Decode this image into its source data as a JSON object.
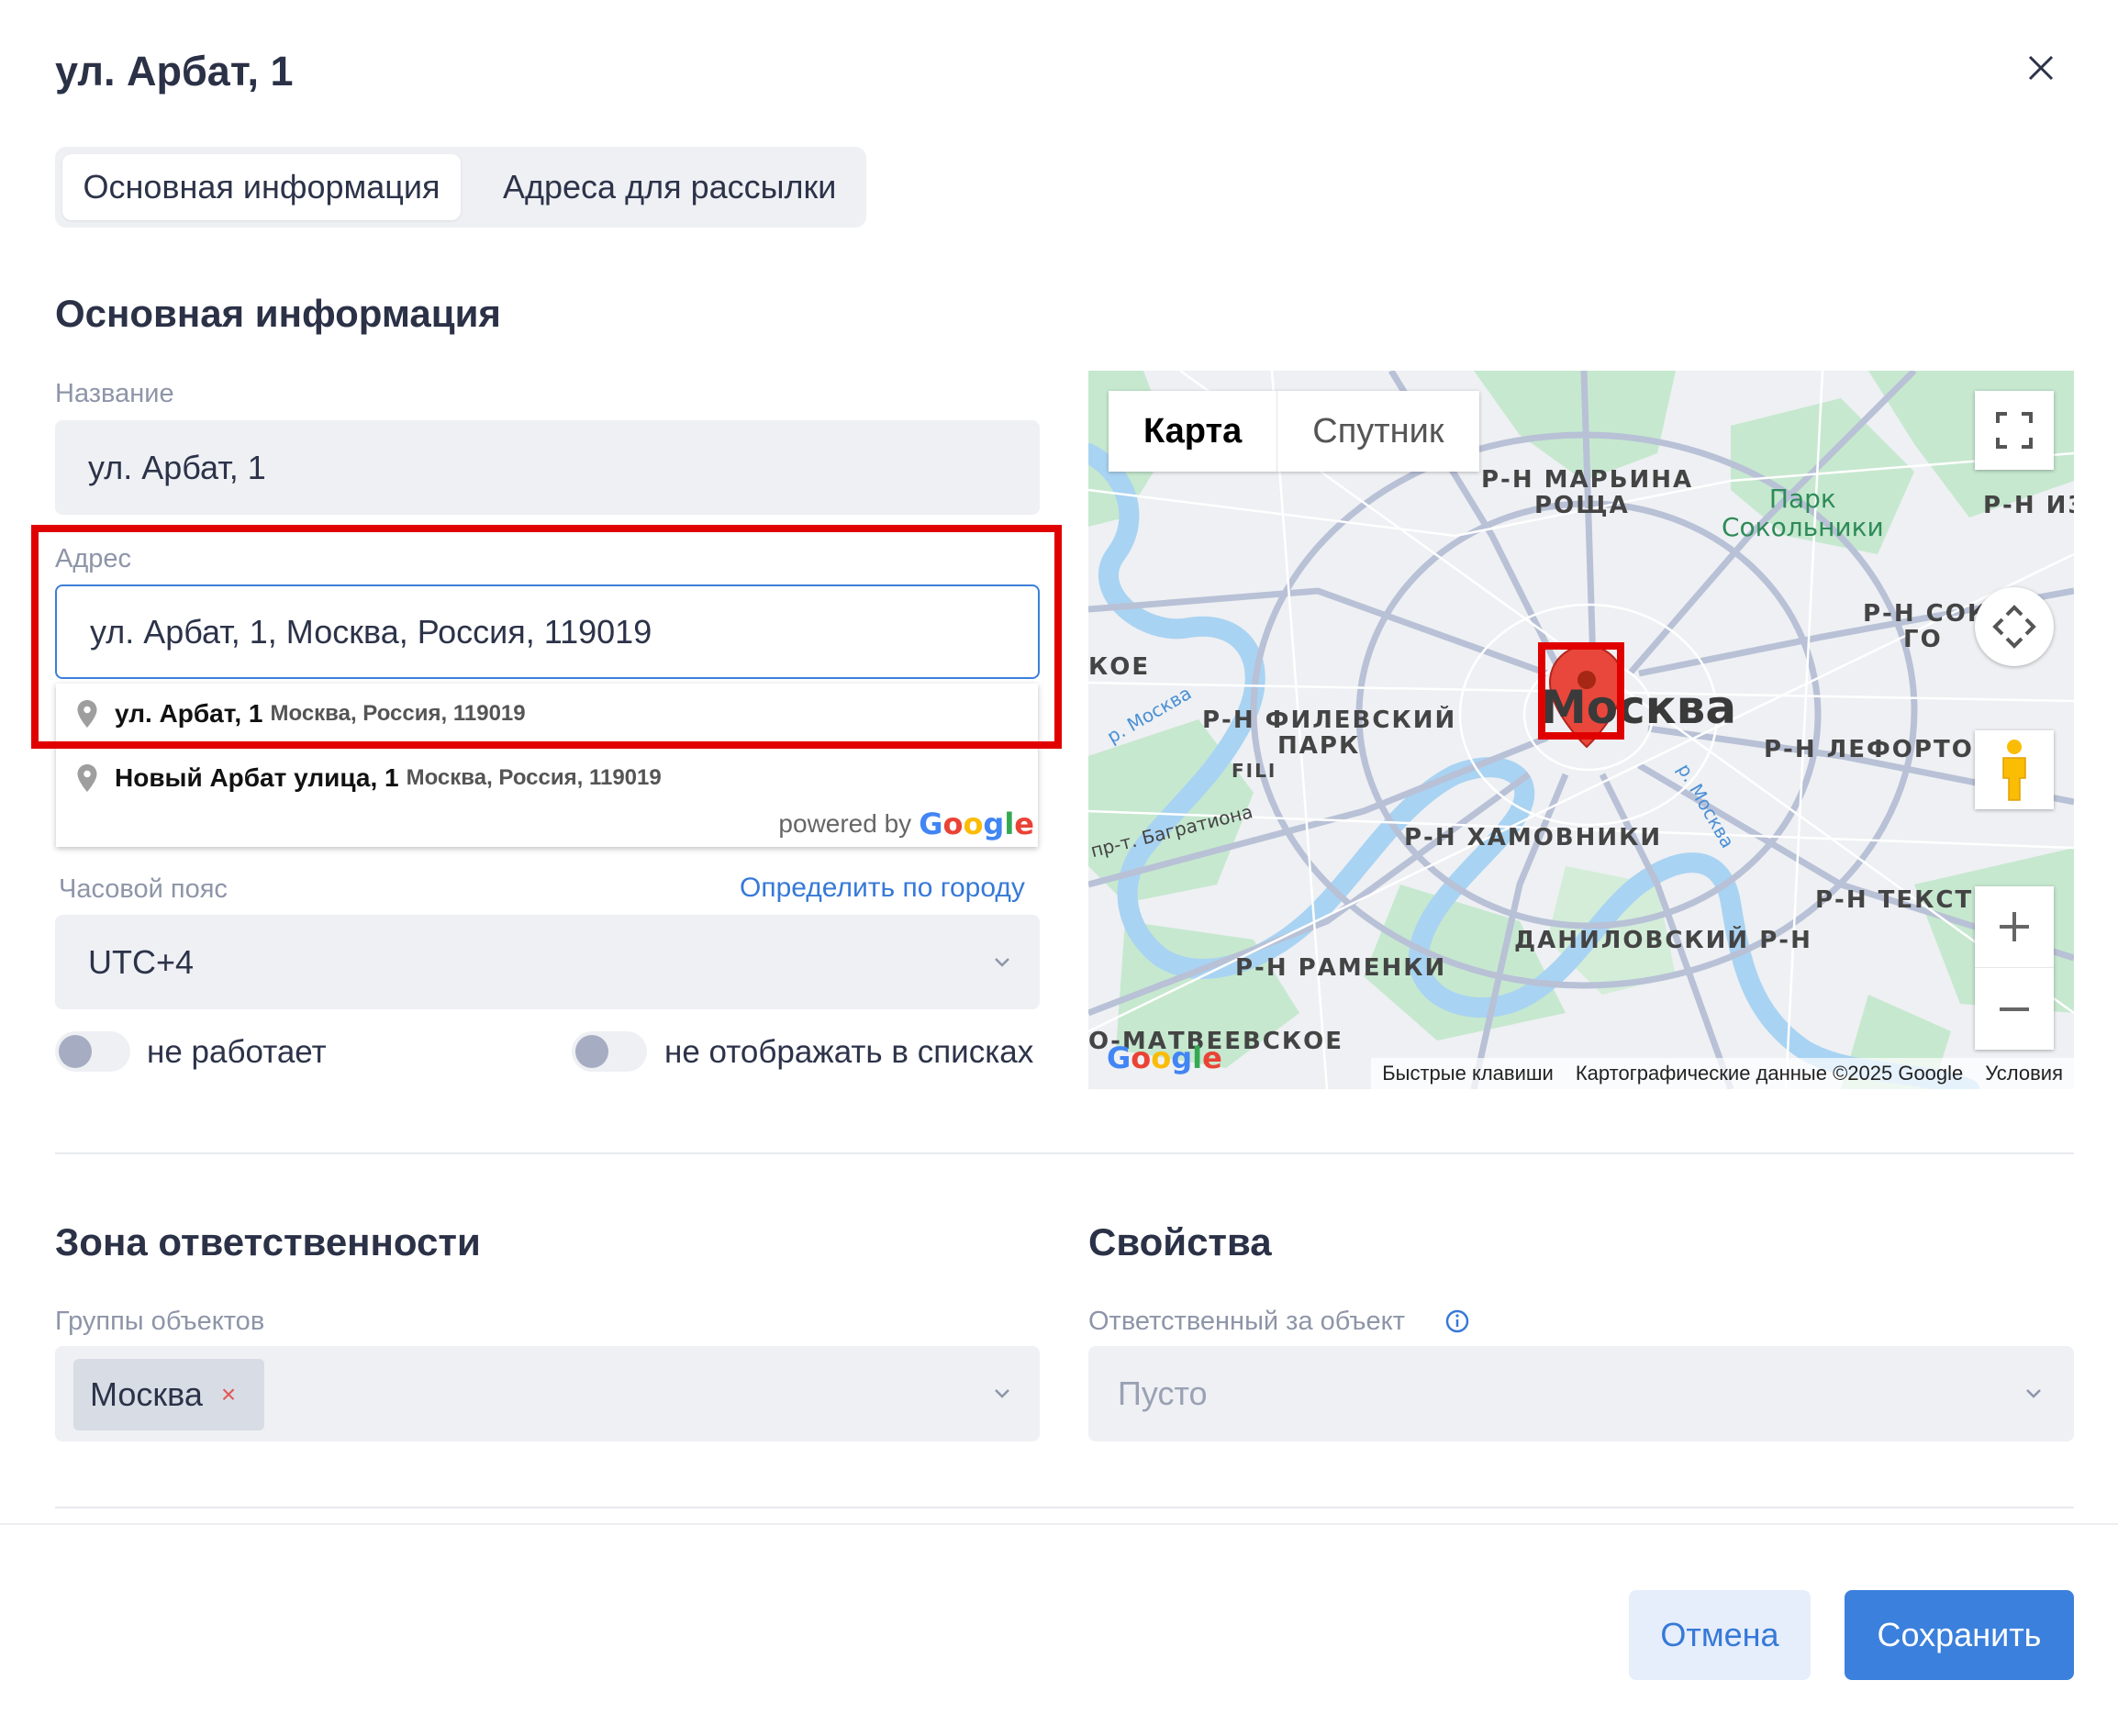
{
  "dialog": {
    "title": "ул. Арбат, 1"
  },
  "tabs": [
    {
      "label": "Основная информация",
      "active": true
    },
    {
      "label": "Адреса для рассылки",
      "active": false
    }
  ],
  "main_info": {
    "section_title": "Основная информация",
    "name_label": "Название",
    "name_value": "ул. Арбат, 1",
    "address_label": "Адрес",
    "address_value": "ул. Арбат, 1, Москва, Россия, 119019",
    "timezone_label": "Часовой пояс",
    "timezone_link": "Определить по городу",
    "timezone_value": "UTC+4",
    "toggle_not_working": "не работает",
    "toggle_hide_in_lists": "не отображать в списках"
  },
  "autocomplete": {
    "items": [
      {
        "main": "ул. Арбат, 1",
        "sub": "Москва, Россия, 119019"
      },
      {
        "main": "Новый Арбат улица, 1",
        "sub": "Москва, Россия, 119019"
      }
    ],
    "powered_by": "powered by"
  },
  "map": {
    "type_map": "Карта",
    "type_satellite": "Спутник",
    "city": "Москва",
    "labels": {
      "maryina": "Р-Н МАРЬИНА",
      "roscha": "РОЩА",
      "park": "Парк",
      "sokolniki": "Сокольники",
      "rniz": "Р-Н ИЗ",
      "sok": "Р-Н СОК",
      "go": "ГО",
      "filevsky": "Р-Н ФИЛЕВСКИЙ",
      "park2": "ПАРК",
      "fili": "FILI",
      "lefortovo": "Р-Н ЛЕФОРТОВО",
      "khamovniki": "Р-Н ХАМОВНИКИ",
      "danilovsky": "ДАНИЛОВСКИЙ Р-Н",
      "tekst": "Р-Н ТЕКСТИ",
      "ramenki": "Р-Н РАМЕНКИ",
      "matveevskoe": "О-МАТВЕЕВСКОЕ",
      "bagrationa": "пр-т. Багратиона",
      "moskva_river": "р. Москва",
      "moskva_river2": "р. Москва",
      "koe": "КОЕ"
    },
    "footer": {
      "shortcuts": "Быстрые клавиши",
      "data": "Картографические данные ©2025 Google",
      "terms": "Условия"
    }
  },
  "responsibility": {
    "section_title": "Зона ответственности",
    "groups_label": "Группы объектов",
    "groups": [
      "Москва"
    ]
  },
  "properties": {
    "section_title": "Свойства",
    "responsible_label": "Ответственный за объект",
    "responsible_placeholder": "Пусто"
  },
  "actions": {
    "cancel": "Отмена",
    "save": "Сохранить"
  },
  "colors": {
    "accent": "#3b80dc",
    "highlight": "#e00000",
    "field_bg": "#eef0f4"
  }
}
